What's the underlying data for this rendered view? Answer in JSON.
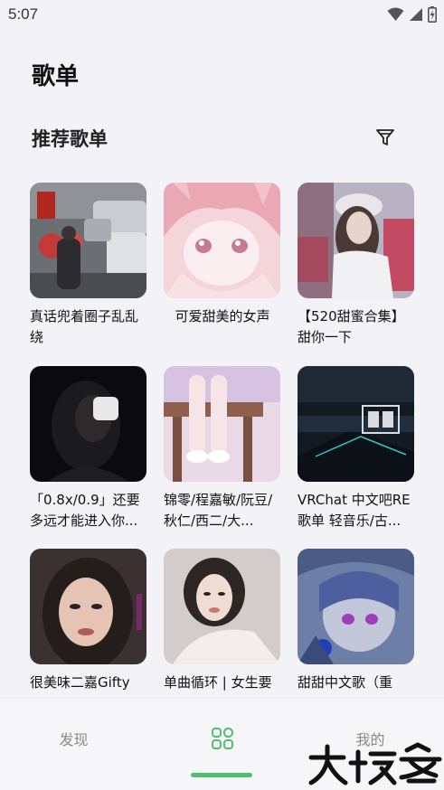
{
  "status_bar": {
    "time": "5:07"
  },
  "header": {
    "title": "歌单"
  },
  "section": {
    "title": "推荐歌单"
  },
  "icons": {
    "filter": "filter-icon",
    "wifi": "wifi-icon",
    "signal": "signal-icon",
    "battery": "battery-icon",
    "grid": "grid-icon"
  },
  "playlists": [
    {
      "title": "真话兜着圈子乱乱绕"
    },
    {
      "title": "可爱甜美的女声"
    },
    {
      "title": "【520甜蜜合集】甜你一下"
    },
    {
      "title": "「0.8x/0.9」还要多远才能进入你..."
    },
    {
      "title": "锦零/程嘉敏/阮豆/秋仁/西二/大..."
    },
    {
      "title": "VRChat 中文吧RE歌单 轻音乐/古..."
    },
    {
      "title": "很美味二嘉Gifty"
    },
    {
      "title": "单曲循环 | 女生要"
    },
    {
      "title": "甜甜中文歌（重"
    }
  ],
  "bottom_nav": {
    "discover": "发现",
    "mine": "我的"
  },
  "colors": {
    "accent": "#4fbf6f",
    "background": "#f2f2f7"
  }
}
